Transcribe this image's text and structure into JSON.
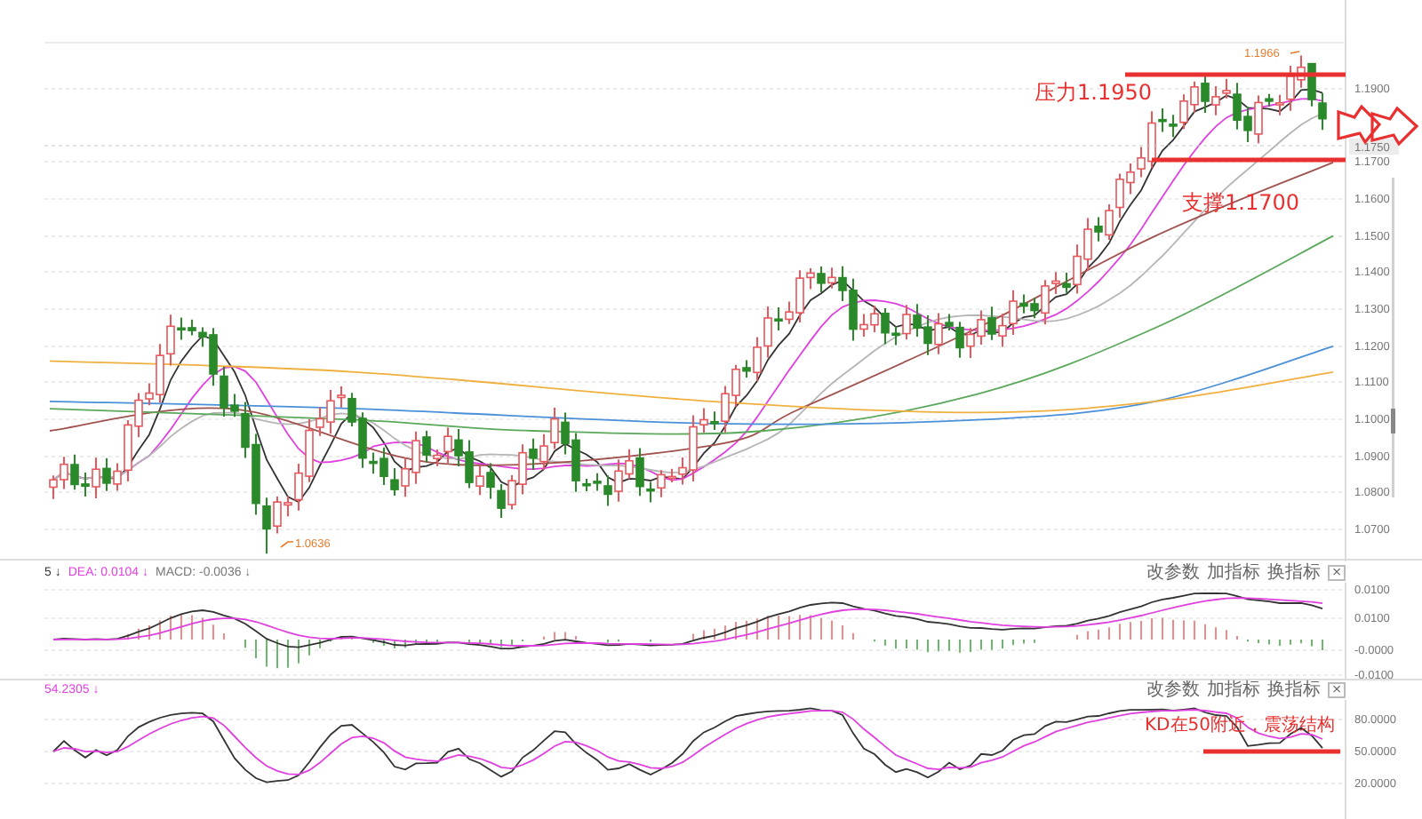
{
  "main_chart": {
    "y_axis_labels": [
      "1.1900",
      "1.1700",
      "1.1600",
      "1.1500",
      "1.1400",
      "1.1300",
      "1.1200",
      "1.1100",
      "1.1000",
      "1.0900",
      "1.0800",
      "1.0700"
    ],
    "current_price": "1.1750",
    "high_marker": "1.1966",
    "low_marker": "1.0636",
    "annotations": [
      {
        "kind": "resistance",
        "text": "压力1.1950"
      },
      {
        "kind": "support",
        "text": "支撑1.1700"
      }
    ]
  },
  "macd_panel": {
    "legend": [
      {
        "text": "5 ↓",
        "color": "#333333"
      },
      {
        "text": "DEA: 0.0104 ↓",
        "color": "#e040e0"
      },
      {
        "text": "MACD: -0.0036 ↓",
        "color": "#777777"
      }
    ],
    "buttons": [
      "改参数",
      "加指标",
      "换指标",
      "×"
    ],
    "y_axis_labels": [
      "0.0100",
      "0.0100",
      "-0.0000",
      "-0.0100"
    ]
  },
  "kd_panel": {
    "legend": [
      {
        "text": "54.2305 ↓",
        "color": "#e040e0"
      }
    ],
    "buttons": [
      "改参数",
      "加指标",
      "换指标",
      "×"
    ],
    "y_axis_labels": [
      "80.0000",
      "50.0000",
      "20.0000"
    ],
    "annotation": "KD在50附近，震荡结构"
  }
}
